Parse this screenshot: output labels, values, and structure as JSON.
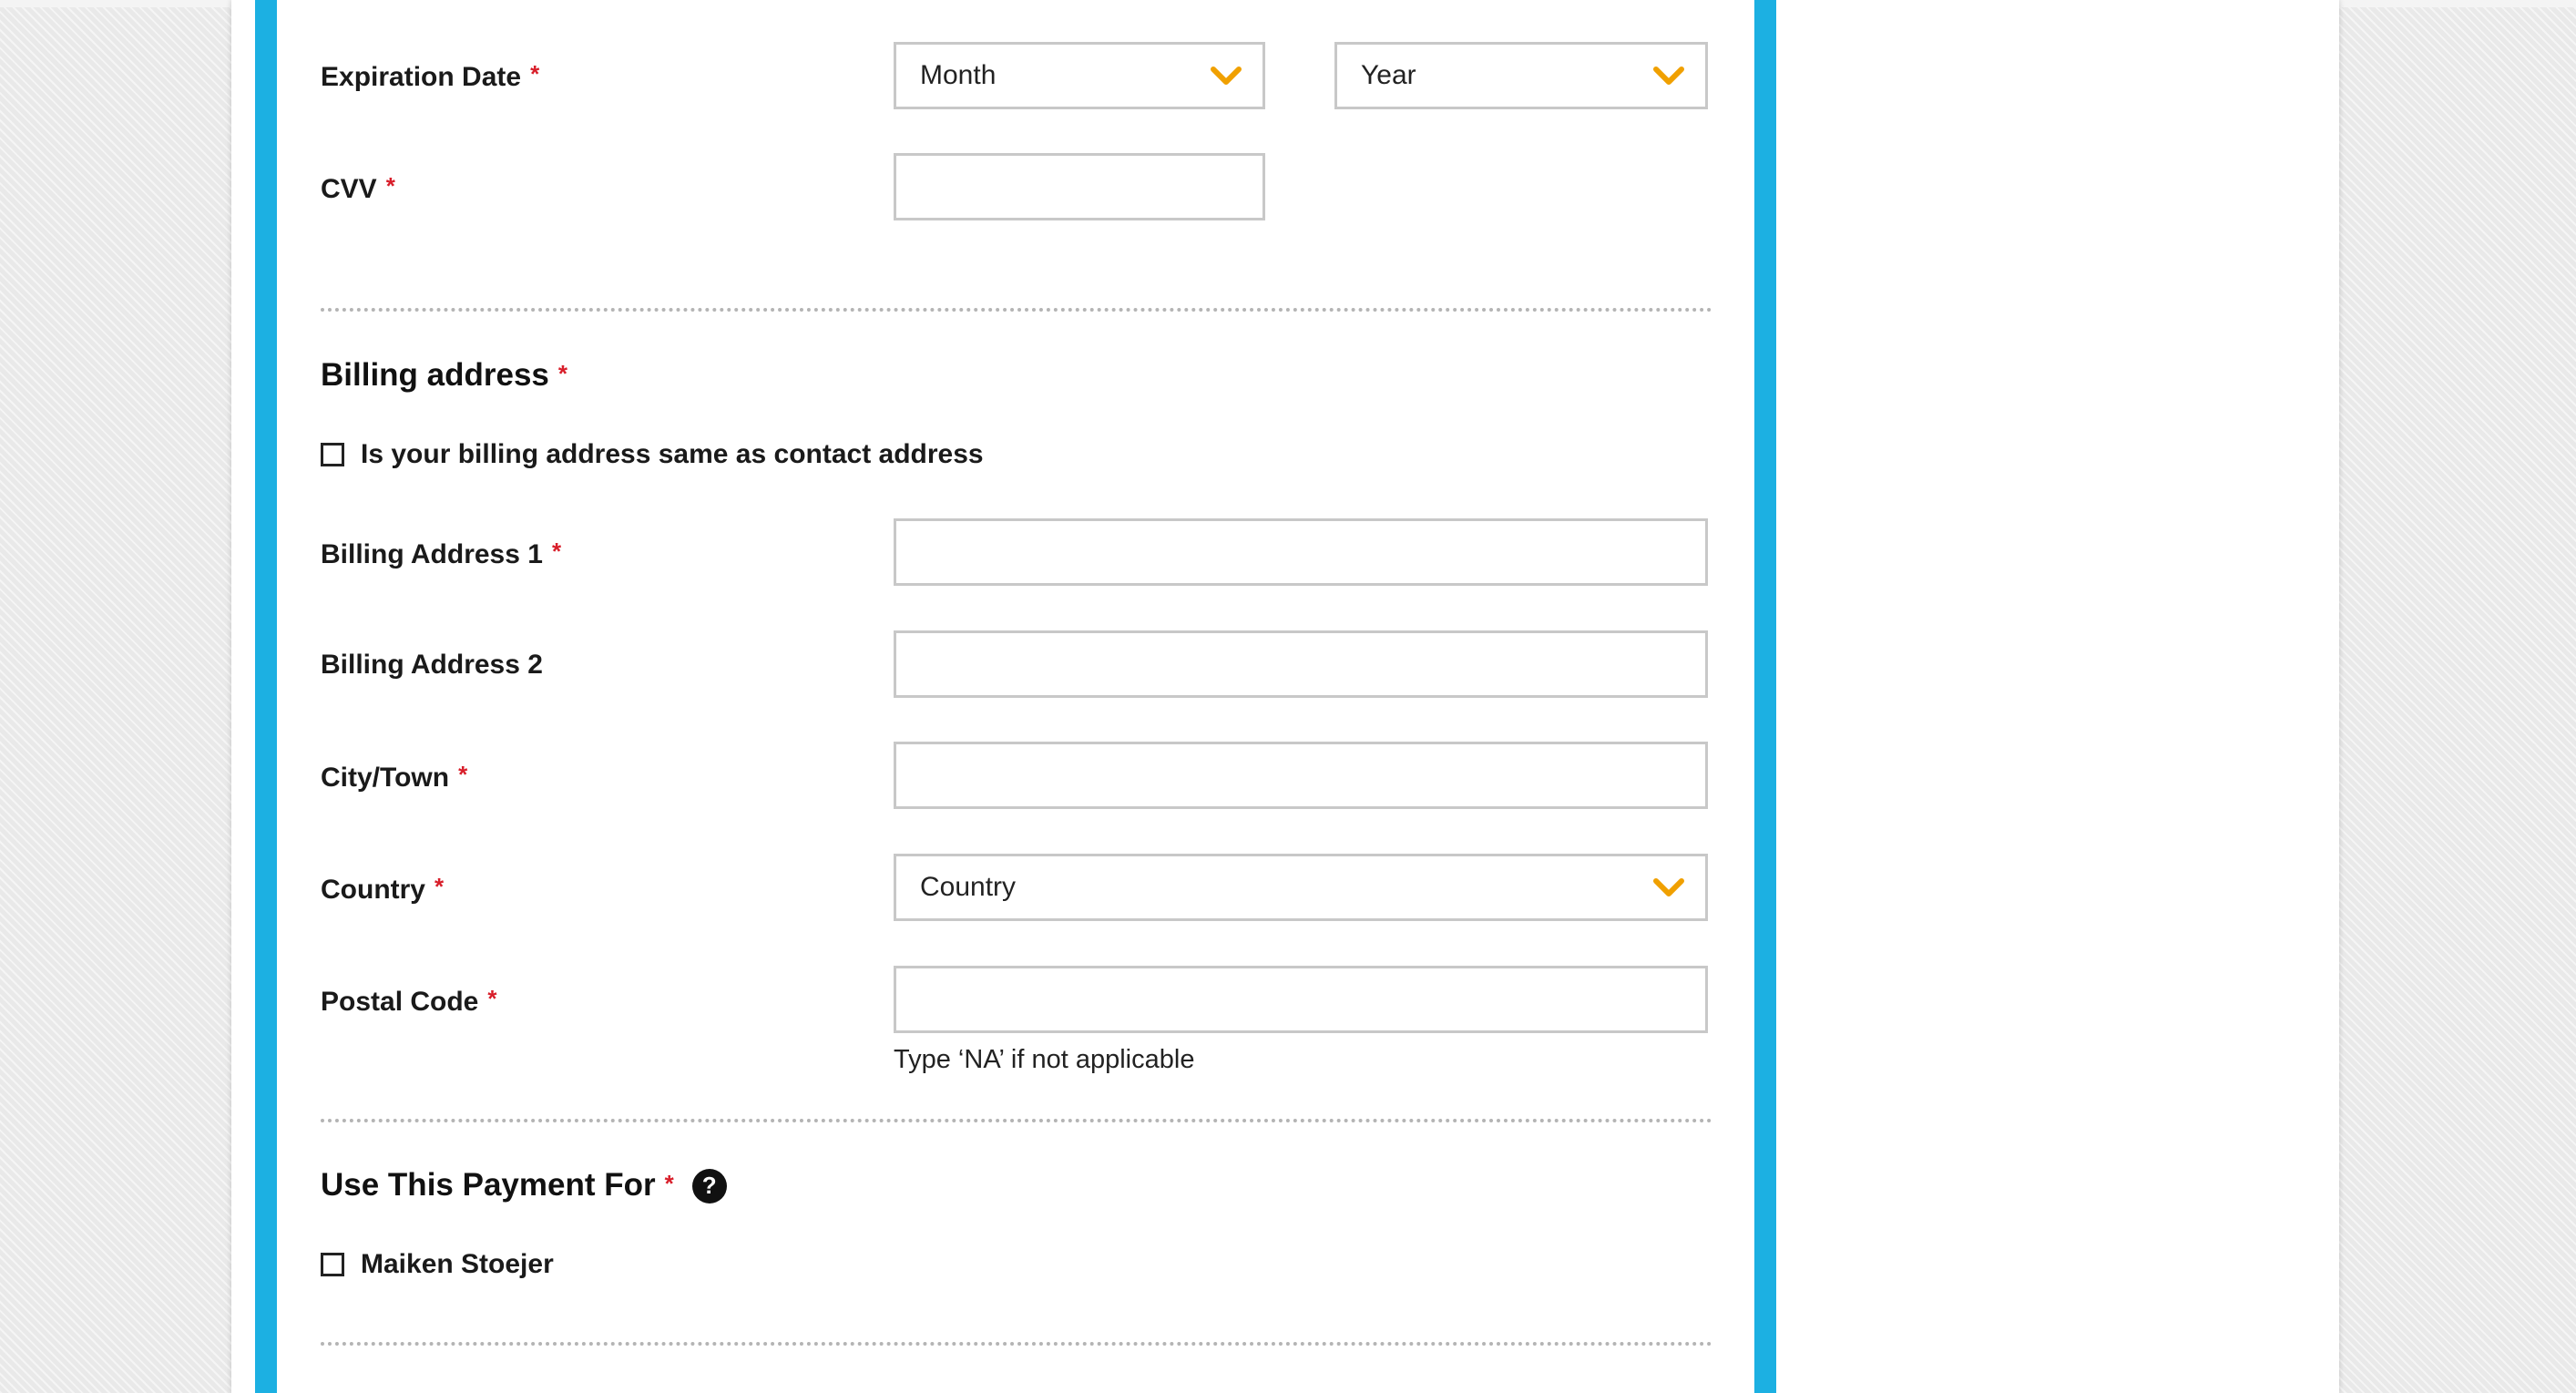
{
  "payment": {
    "expiration": {
      "label": "Expiration Date",
      "required": "*",
      "month_value": "Month",
      "year_value": "Year"
    },
    "cvv": {
      "label": "CVV",
      "required": "*",
      "value": ""
    }
  },
  "billing": {
    "section_title": "Billing address",
    "required": "*",
    "same_as_contact_label": "Is your billing address same as contact address",
    "address1": {
      "label": "Billing Address 1",
      "required": "*",
      "value": ""
    },
    "address2": {
      "label": "Billing Address 2",
      "value": ""
    },
    "city": {
      "label": "City/Town",
      "required": "*",
      "value": ""
    },
    "country": {
      "label": "Country",
      "required": "*",
      "value": "Country"
    },
    "postal": {
      "label": "Postal Code",
      "required": "*",
      "value": "",
      "hint": "Type ‘NA’ if not applicable"
    }
  },
  "use_payment": {
    "section_title": "Use This Payment For",
    "required": "*",
    "help_glyph": "?",
    "options": [
      {
        "label": "Maiken Stoejer"
      }
    ]
  },
  "colors": {
    "accent": "#1cb0e2",
    "required": "#d81e2a",
    "chevron": "#f0a000"
  }
}
